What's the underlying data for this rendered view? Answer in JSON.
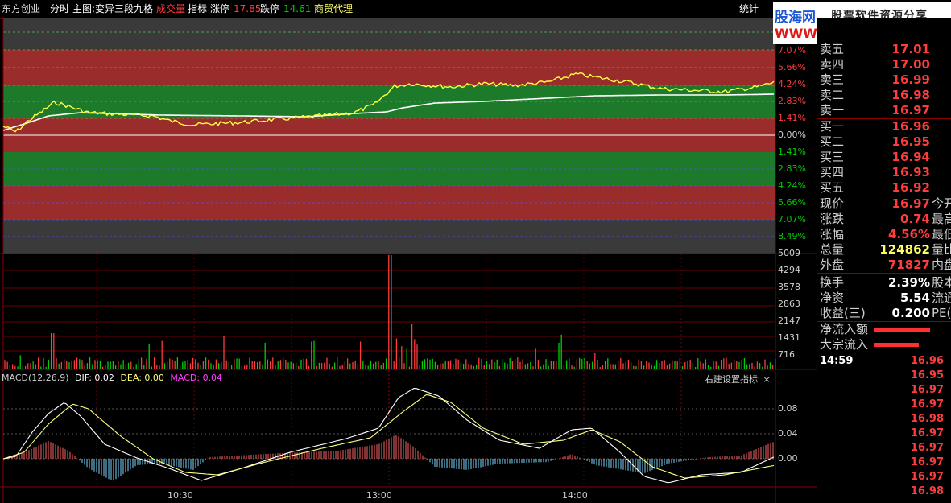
{
  "topbar": {
    "stock_name": "东方创业",
    "mode": "分时",
    "main_chart": "主图:变异三段九格",
    "volume_label": "成交量",
    "indicator_label": "指标",
    "limit_up_label": "涨停",
    "limit_up_value": "17.85",
    "limit_down_label": "跌停",
    "limit_down_value": "14.61",
    "sector": "商贸代理",
    "stats_label": "统计"
  },
  "logo": {
    "site_name": "股海网",
    "slogan": "股票软件资源分享",
    "url": "WWW.Guhai.com.cn"
  },
  "price_axis": {
    "labels_up": [
      "7.07%",
      "5.66%",
      "4.24%",
      "2.83%",
      "1.41%"
    ],
    "zero": "0.00%",
    "labels_down": [
      "1.41%",
      "2.83%",
      "4.24%",
      "5.66%",
      "7.07%",
      "8.49%"
    ]
  },
  "volume_axis": {
    "labels": [
      "5009",
      "4294",
      "3578",
      "2863",
      "2147",
      "1431",
      "716"
    ]
  },
  "macd": {
    "title": "MACD(12,26,9)",
    "dif_label": "DIF: 0.02",
    "dea_label": "DEA: 0.00",
    "macd_label": "MACD: 0.04",
    "settings_label": "右建设置指标",
    "close_label": "×",
    "axis": [
      "0.08",
      "0.04",
      "0.00"
    ]
  },
  "time_axis": [
    "10:30",
    "13:00",
    "14:00"
  ],
  "orderbook": {
    "asks": [
      {
        "label": "卖五",
        "price": "17.01"
      },
      {
        "label": "卖四",
        "price": "17.00"
      },
      {
        "label": "卖三",
        "price": "16.99"
      },
      {
        "label": "卖二",
        "price": "16.98"
      },
      {
        "label": "卖一",
        "price": "16.97"
      }
    ],
    "bids": [
      {
        "label": "买一",
        "price": "16.96"
      },
      {
        "label": "买二",
        "price": "16.95"
      },
      {
        "label": "买三",
        "price": "16.94"
      },
      {
        "label": "买四",
        "price": "16.93"
      },
      {
        "label": "买五",
        "price": "16.92"
      }
    ]
  },
  "quote": [
    {
      "label": "现价",
      "value": "16.97",
      "label2": "今开"
    },
    {
      "label": "涨跌",
      "value": "0.74",
      "label2": "最高"
    },
    {
      "label": "涨幅",
      "value": "4.56%",
      "label2": "最低"
    },
    {
      "label": "总量",
      "value": "124862",
      "label2": "量比"
    },
    {
      "label": "外盘",
      "value": "71827",
      "label2": "内盘"
    }
  ],
  "fundamentals": [
    {
      "label": "换手",
      "value": "2.39%",
      "label2": "股本"
    },
    {
      "label": "净资",
      "value": "5.54",
      "label2": "流通"
    },
    {
      "label": "收益(三)",
      "value": "0.200",
      "label2": "PE(动"
    }
  ],
  "flows": [
    {
      "label": "净流入额"
    },
    {
      "label": "大宗流入"
    }
  ],
  "ticks": {
    "time": "14:59",
    "prices": [
      "16.96",
      "16.95",
      "16.97",
      "16.97",
      "16.98",
      "16.97",
      "16.97",
      "16.97",
      "16.97",
      "16.98"
    ]
  },
  "colors": {
    "up": "#ff3c3c",
    "down": "#00d000",
    "price_line": "#ffff40",
    "avg_line": "#ffffff",
    "band_red": "#9b2c2c",
    "band_green": "#1d7a2a",
    "band_gray": "#3a3a3a",
    "macd_red": "#ff6464",
    "macd_blue": "#7ad8ff"
  }
}
